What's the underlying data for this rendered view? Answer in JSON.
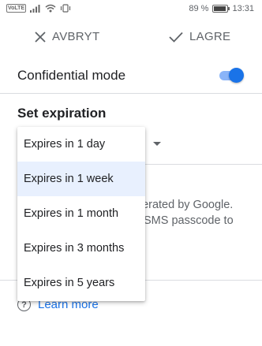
{
  "status_bar": {
    "network_badge": "VoLTE",
    "battery_percent": "89 %",
    "battery_level": 0.89,
    "time": "13:31"
  },
  "toolbar": {
    "cancel_label": "AVBRYT",
    "save_label": "LAGRE"
  },
  "confidential": {
    "label": "Confidential mode",
    "enabled": true,
    "accent_color": "#1a73e8"
  },
  "expiration": {
    "title": "Set expiration"
  },
  "info": {
    "line1": "nerated by Google.",
    "line2": "SMS passcode to"
  },
  "learn_more": {
    "label": "Learn more"
  },
  "menu": {
    "selected_index": 1,
    "items": [
      "Expires in 1 day",
      "Expires in 1 week",
      "Expires in 1 month",
      "Expires in 3 months",
      "Expires in 5 years"
    ]
  }
}
